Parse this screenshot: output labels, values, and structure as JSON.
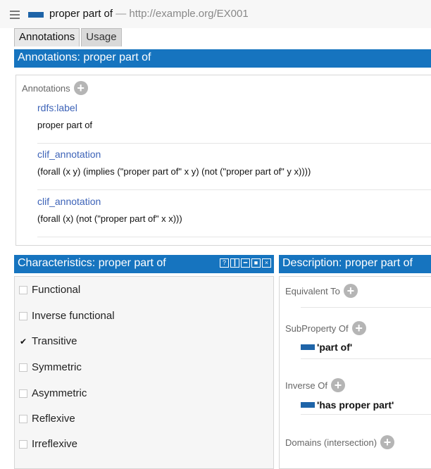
{
  "header": {
    "property_name": "proper part of",
    "separator": "—",
    "iri": "http://example.org/EX001"
  },
  "tabs": [
    {
      "label": "Annotations",
      "active": true
    },
    {
      "label": "Usage",
      "active": false
    }
  ],
  "annotations_panel": {
    "title": "Annotations: proper part of",
    "section_label": "Annotations",
    "items": [
      {
        "property": "rdfs:label",
        "value": "proper part of"
      },
      {
        "property": "clif_annotation",
        "value": "(forall (x y) (implies (\"proper part of\" x y) (not (\"proper part of\" y x))))"
      },
      {
        "property": "clif_annotation",
        "value": "(forall (x) (not (\"proper part of\" x x)))"
      }
    ]
  },
  "characteristics_panel": {
    "title": "Characteristics: proper part of",
    "items": [
      {
        "label": "Functional",
        "checked": false
      },
      {
        "label": "Inverse functional",
        "checked": false
      },
      {
        "label": "Transitive",
        "checked": true
      },
      {
        "label": "Symmetric",
        "checked": false
      },
      {
        "label": "Asymmetric",
        "checked": false
      },
      {
        "label": "Reflexive",
        "checked": false
      },
      {
        "label": "Irreflexive",
        "checked": false
      }
    ],
    "check_glyph": "✔"
  },
  "description_panel": {
    "title": "Description: proper part of",
    "sections": [
      {
        "label": "Equivalent To",
        "entries": []
      },
      {
        "label": "SubProperty Of",
        "entries": [
          "'part of'"
        ]
      },
      {
        "label": "Inverse Of",
        "entries": [
          "'has proper part'"
        ]
      },
      {
        "label": "Domains (intersection)",
        "entries": []
      }
    ]
  },
  "add_glyph": "+",
  "colors": {
    "accent": "#1674bf",
    "property_swatch": "#1e64a8",
    "annotation_property": "#3d63b8"
  }
}
